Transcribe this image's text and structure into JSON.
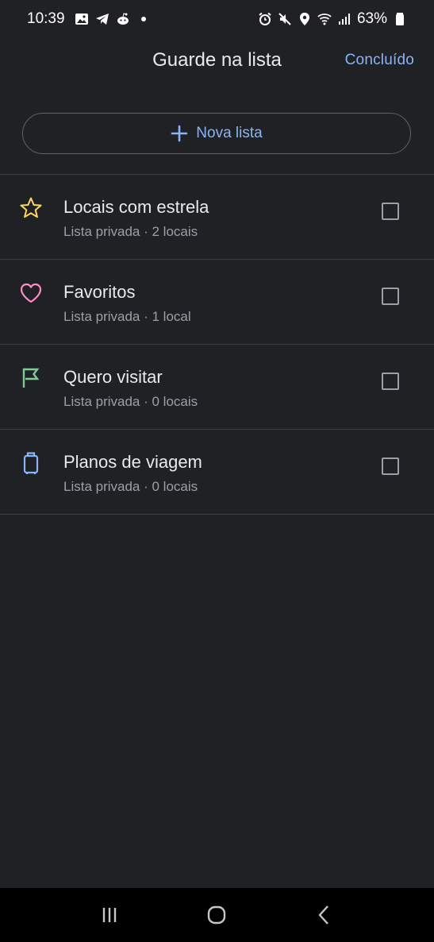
{
  "status_bar": {
    "time": "10:39",
    "battery": "63%",
    "left_icons": [
      "gallery-icon",
      "telegram-icon",
      "reddit-icon",
      "dot-icon"
    ],
    "right_icons": [
      "alarm-icon",
      "mute-icon",
      "location-icon",
      "wifi-icon",
      "signal-icon",
      "battery-icon"
    ]
  },
  "header": {
    "title": "Guarde na lista",
    "done_label": "Concluído"
  },
  "new_list": {
    "label": "Nova lista",
    "icon": "plus-icon"
  },
  "lists": [
    {
      "title": "Locais com estrela",
      "subtitle": "Lista privada · 2 locais",
      "icon": "star-icon",
      "color": "#fdd663",
      "checked": false
    },
    {
      "title": "Favoritos",
      "subtitle": "Lista privada · 1 local",
      "icon": "heart-icon",
      "color": "#ff8bcb",
      "checked": false
    },
    {
      "title": "Quero visitar",
      "subtitle": "Lista privada · 0 locais",
      "icon": "flag-icon",
      "color": "#81c995",
      "checked": false
    },
    {
      "title": "Planos de viagem",
      "subtitle": "Lista privada · 0 locais",
      "icon": "suitcase-icon",
      "color": "#8ab4f8",
      "checked": false
    }
  ],
  "colors": {
    "background": "#202124",
    "accent": "#8ab4f8",
    "divider": "#3c4043"
  },
  "nav_bar": {
    "buttons": [
      "recent-apps-icon",
      "home-icon",
      "back-icon"
    ]
  }
}
